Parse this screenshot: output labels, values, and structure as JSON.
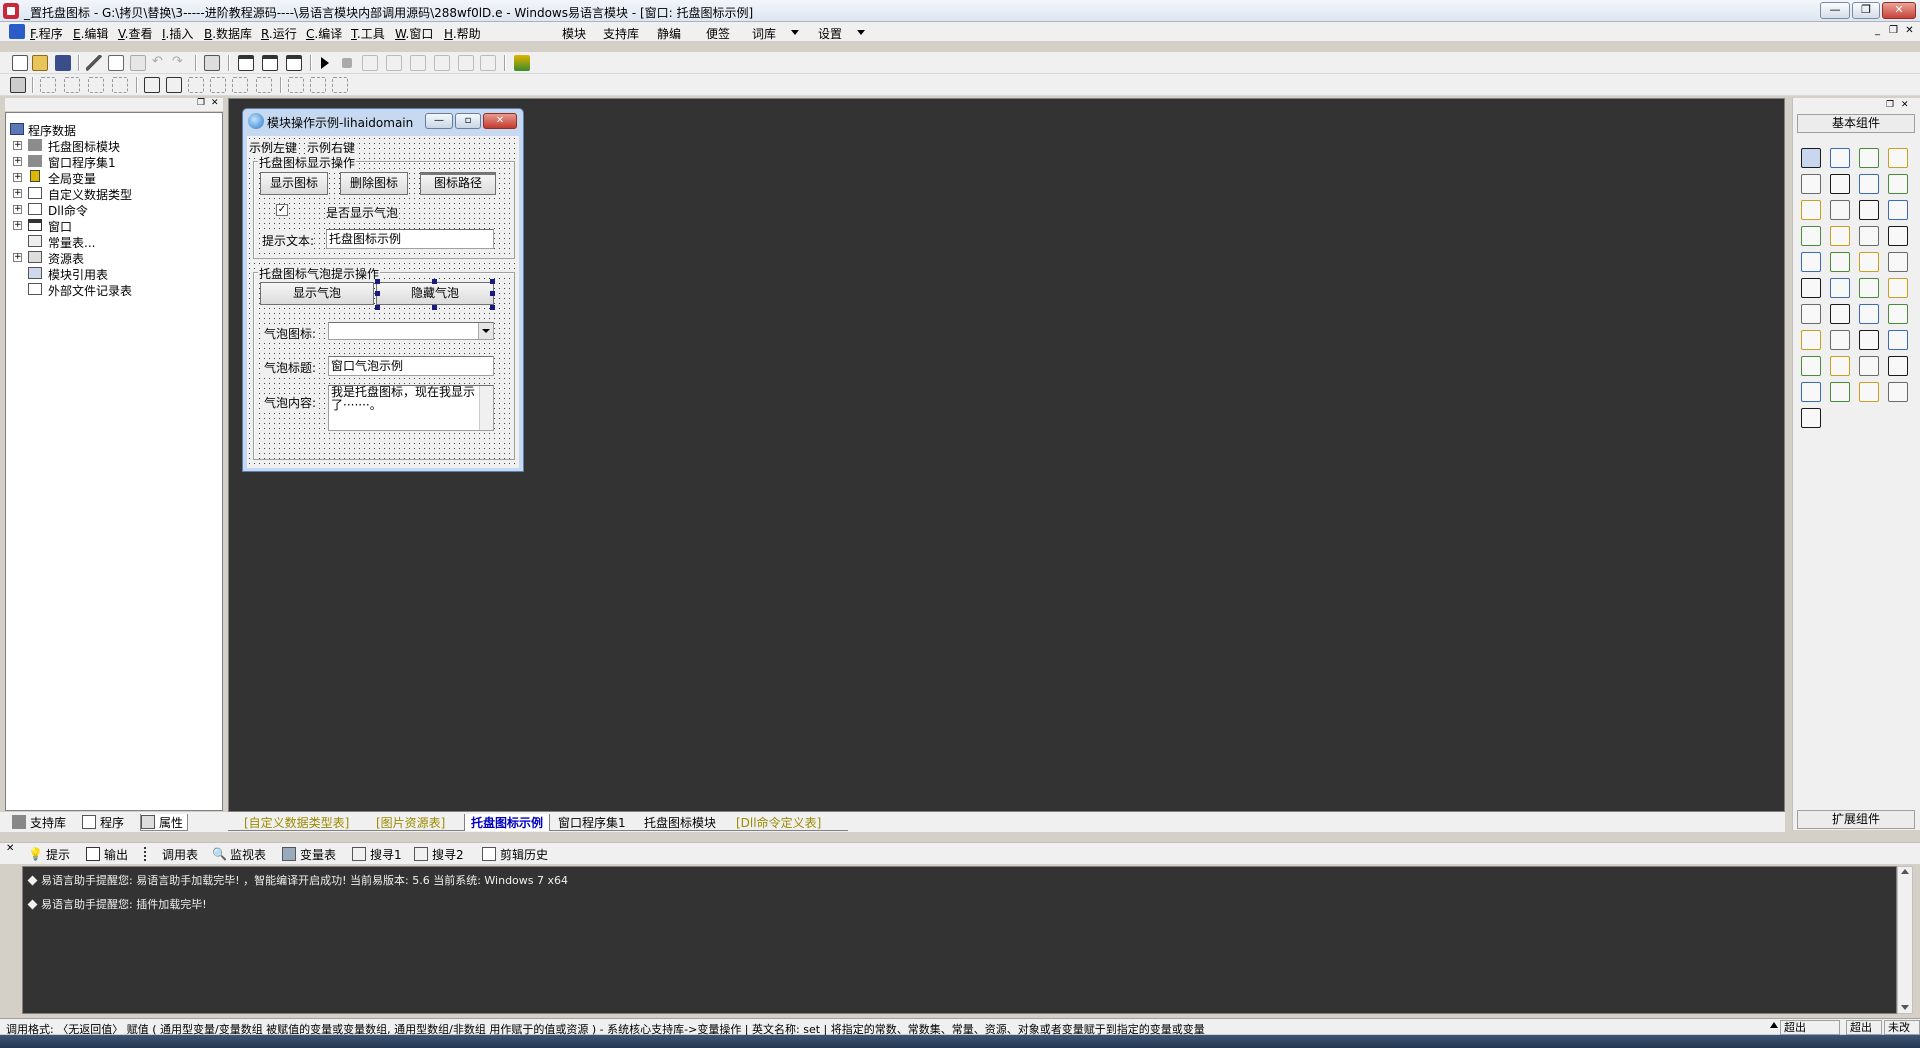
{
  "window": {
    "title": "_置托盘图标 - G:\\拷贝\\替换\\3-----进阶教程源码----\\易语言模块内部调用源码\\288wf0lD.e - Windows易语言模块 - [窗口: 托盘图标示例]",
    "minimize": "—",
    "maximize": "❐",
    "close": "✕"
  },
  "menu": {
    "items": [
      {
        "key": "F",
        "label": ".程序"
      },
      {
        "key": "E",
        "label": ".编辑"
      },
      {
        "key": "V",
        "label": ".查看"
      },
      {
        "key": "I",
        "label": ".插入"
      },
      {
        "key": "B",
        "label": ".数据库"
      },
      {
        "key": "R",
        "label": ".运行"
      },
      {
        "key": "C",
        "label": ".编译"
      },
      {
        "key": "T",
        "label": ".工具"
      },
      {
        "key": "W",
        "label": ".窗口"
      },
      {
        "key": "H",
        "label": ".帮助"
      }
    ],
    "extra": [
      "模块",
      "支持库",
      "静编",
      "便签",
      "词库",
      "设置"
    ],
    "mdi": [
      "_",
      "❐",
      "✕"
    ]
  },
  "left_panel": {
    "tree": [
      {
        "label": "程序数据",
        "icon": "program-data-icon",
        "expander": ""
      },
      {
        "label": "托盘图标模块",
        "icon": "module-icon",
        "expander": "+"
      },
      {
        "label": "窗口程序集1",
        "icon": "assembly-icon",
        "expander": "+"
      },
      {
        "label": "全局变量",
        "icon": "global-var-icon",
        "expander": "+"
      },
      {
        "label": "自定义数据类型",
        "icon": "custom-type-icon",
        "expander": "+"
      },
      {
        "label": "Dll命令",
        "icon": "dll-icon",
        "expander": "+"
      },
      {
        "label": "窗口",
        "icon": "window-icon",
        "expander": "+"
      },
      {
        "label": "常量表...",
        "icon": "constant-icon",
        "expander": ""
      },
      {
        "label": "资源表",
        "icon": "resource-icon",
        "expander": "+"
      },
      {
        "label": "模块引用表",
        "icon": "module-ref-icon",
        "expander": ""
      },
      {
        "label": "外部文件记录表",
        "icon": "external-file-icon",
        "expander": ""
      }
    ],
    "tabs": [
      "支持库",
      "程序",
      "属性"
    ]
  },
  "form_window": {
    "title": "模块操作示例-lihaidomain",
    "menu_left": "示例左键",
    "menu_right": "示例右键",
    "group1_title": "托盘图标显示操作",
    "btn_show_icon": "显示图标",
    "btn_delete_icon": "删除图标",
    "btn_icon_path": "图标路径",
    "checkbox_mark": "✓",
    "checkbox_label": "是否显示气泡",
    "tip_label": "提示文本:",
    "tip_value": "托盘图标示例",
    "group2_title": "托盘图标气泡提示操作",
    "btn_show_bubble": "显示气泡",
    "btn_hide_bubble": "隐藏气泡",
    "bubble_icon_label": "气泡图标:",
    "bubble_icon_value": "",
    "bubble_title_label": "气泡标题:",
    "bubble_title_value": "窗口气泡示例",
    "bubble_content_label": "气泡内容:",
    "bubble_content_value": "我是托盘图标，现在我显示了·······。"
  },
  "design_tabs": [
    {
      "label": "[自定义数据类型表]",
      "color": "#9a8a00",
      "active": false
    },
    {
      "label": "[图片资源表]",
      "color": "#9a8a00",
      "active": false
    },
    {
      "label": "托盘图标示例",
      "color": "#0000c0",
      "active": true
    },
    {
      "label": "窗口程序集1",
      "color": "#000000",
      "active": false
    },
    {
      "label": "托盘图标模块",
      "color": "#000000",
      "active": false
    },
    {
      "label": "[Dll命令定义表]",
      "color": "#9a8a00",
      "active": false
    }
  ],
  "right_panel": {
    "basic_header": "基本组件",
    "extended_header": "扩展组件"
  },
  "output": {
    "tabs": [
      "提示",
      "输出",
      "调用表",
      "监视表",
      "变量表",
      "搜寻1",
      "搜寻2",
      "剪辑历史"
    ],
    "lines": [
      "易语言助手提醒您: 易语言助手加载完毕! ，智能编译开启成功! 当前易版本: 5.6 当前系统: Windows 7 x64",
      "易语言助手提醒您: 插件加载完毕!"
    ]
  },
  "status": {
    "text": "调用格式: 〈无返回值〉 赋值 ( 通用型变量/变量数组 被赋值的变量或变量数组, 通用型数组/非数组 用作赋于的值或资源 ) - 系统核心支持库->变量操作 | 英文名称: set | 将指定的常数、常数集、常量、资源、对象或者变量赋于到指定的变量或变量",
    "box1": "超出",
    "box2": "超出",
    "box3": "未改"
  }
}
